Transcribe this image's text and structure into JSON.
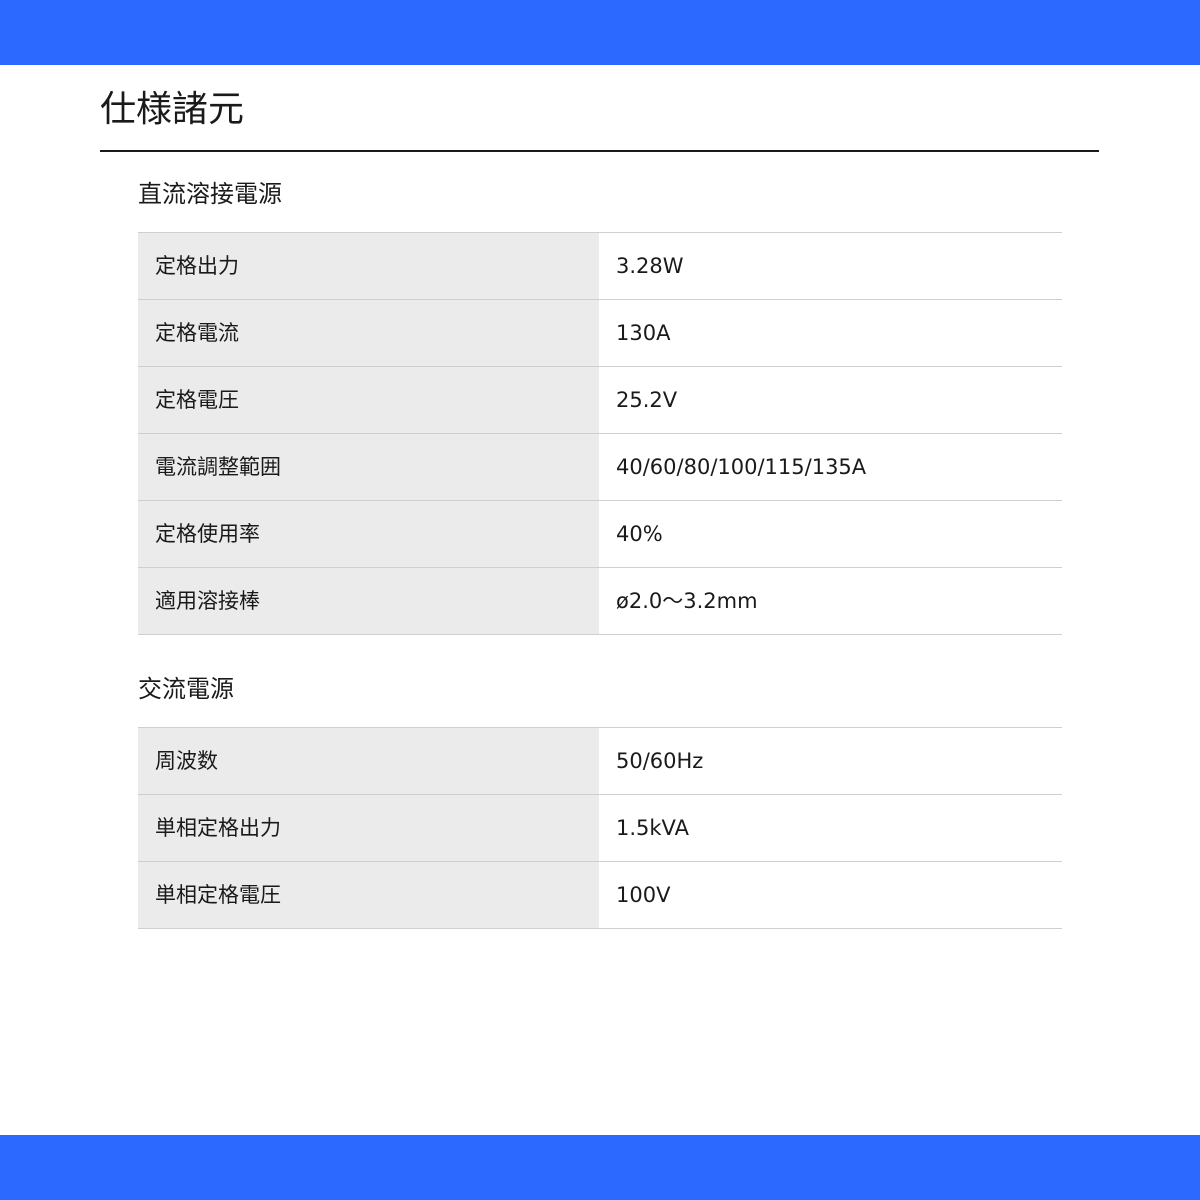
{
  "page": {
    "title": "仕様諸元"
  },
  "sections": [
    {
      "title": "直流溶接電源",
      "rows": [
        {
          "label": "定格出力",
          "value": "3.28W"
        },
        {
          "label": "定格電流",
          "value": "130A"
        },
        {
          "label": "定格電圧",
          "value": "25.2V"
        },
        {
          "label": "電流調整範囲",
          "value": "40/60/80/100/115/135A"
        },
        {
          "label": "定格使用率",
          "value": "40%"
        },
        {
          "label": "適用溶接棒",
          "value": "ø2.0～3.2mm"
        }
      ]
    },
    {
      "title": "交流電源",
      "rows": [
        {
          "label": "周波数",
          "value": "50/60Hz"
        },
        {
          "label": "単相定格出力",
          "value": "1.5kVA"
        },
        {
          "label": "単相定格電圧",
          "value": "100V"
        }
      ]
    }
  ],
  "colors": {
    "accent_band": "#2b69ff",
    "label_cell_bg": "#ebebeb",
    "row_border": "#cfcfcf"
  }
}
